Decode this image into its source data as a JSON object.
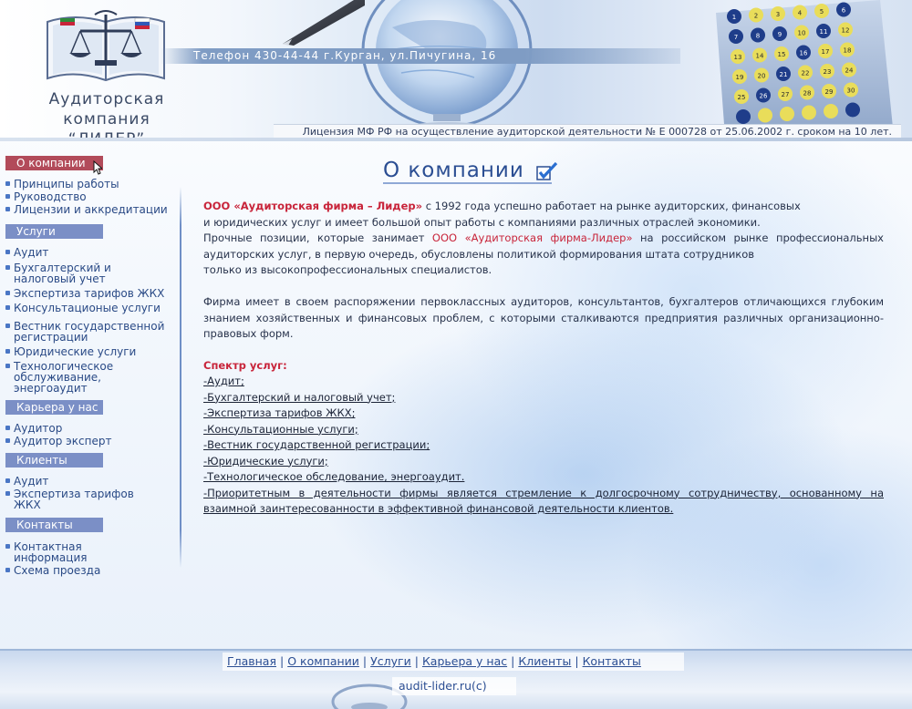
{
  "header": {
    "company_name_line1": "Аудиторская компания",
    "company_name_line2": "“ЛИДЕР”",
    "phone_line": "Телефон 430-44-44 г.Курган, ул.Пичугина, 16",
    "license": "Лицензия МФ РФ на осуществление аудиторской деятельности № Е 000728 от 25.06.2002 г. сроком на 10 лет.",
    "calendar_days": [
      "1",
      "2",
      "3",
      "4",
      "5",
      "6",
      "7",
      "8",
      "9",
      "10",
      "11",
      "12",
      "13",
      "14",
      "15",
      "16",
      "17",
      "18",
      "19",
      "20",
      "21",
      "22",
      "23",
      "24",
      "25",
      "26",
      "27",
      "28",
      "29",
      "30"
    ]
  },
  "sidebar": {
    "sections": [
      {
        "title": "О компании",
        "items": [
          "Принципы работы",
          "Руководство",
          "Лицензии и аккредитации"
        ]
      },
      {
        "title": "Услуги",
        "items": [
          "Аудит",
          "Бухгалтерский и налоговый учет",
          "Экспертиза тарифов ЖКХ",
          "Консультационые услуги",
          "Вестник государственной регистрации",
          "Юридические услуги",
          "Технологическое обслуживание, энергоаудит"
        ]
      },
      {
        "title": "Карьера у нас",
        "items": [
          "Аудитор",
          "Аудитор эксперт"
        ]
      },
      {
        "title": "Клиенты",
        "items": [
          "Аудит",
          "Экспертиза тарифов ЖКХ"
        ]
      },
      {
        "title": "Контакты",
        "items": [
          "Контактная информация",
          "Схема проезда"
        ]
      }
    ]
  },
  "main": {
    "title": "О компании",
    "p1_company": "ООО «Аудиторская фирма – Лидер»",
    "p1_text": " с 1992 года успешно работает на рынке аудиторских, финансовых",
    "p1_text2": "и юридических услуг и имеет большой опыт работы с компаниями различных отраслей экономики.",
    "p2_text_a": "Прочные позиции, которые занимает ",
    "p2_company": "ООО «Аудиторская фирма-Лидер»",
    "p2_text_b": " на российском рынке профессиональных аудиторских услуг, в первую очередь, обусловлены политикой формирования штата сотрудников",
    "p2_text_c": "только из высокопрофессиональных специалистов.",
    "p3": "Фирма имеет в своем распоряжении первоклассных аудиторов, консультантов, бухгалтеров отличающихся глубоким знанием хозяйственных и финансовых проблем, с которыми сталкиваются предприятия различных организационно-правовых форм.",
    "services_title": "Спектр услуг:",
    "services": [
      "-Аудит;",
      "-Бухгалтерский и налоговый учет;",
      "-Экспертиза тарифов ЖКХ;",
      "-Консультационные услуги;",
      "-Вестник государственной регистрации;",
      "-Юридические услуги;",
      "-Технологическое обследование, энергоаудит.",
      "-Приоритетным в деятельности фирмы является стремление к долгосрочному сотрудничеству, основанному на взаимной заинтересованности в эффективной финансовой деятельности клиентов."
    ]
  },
  "footer": {
    "links": [
      "Главная",
      "О компании",
      "Услуги",
      "Карьера у нас",
      "Клиенты",
      "Контакты"
    ],
    "separator": "|",
    "copyright": "audit-lider.ru(c)"
  },
  "colors": {
    "accent_red": "#c8243a",
    "nav_active": "#b24b5a",
    "nav_section": "#7b8fc6",
    "link_blue": "#2a4a86"
  }
}
